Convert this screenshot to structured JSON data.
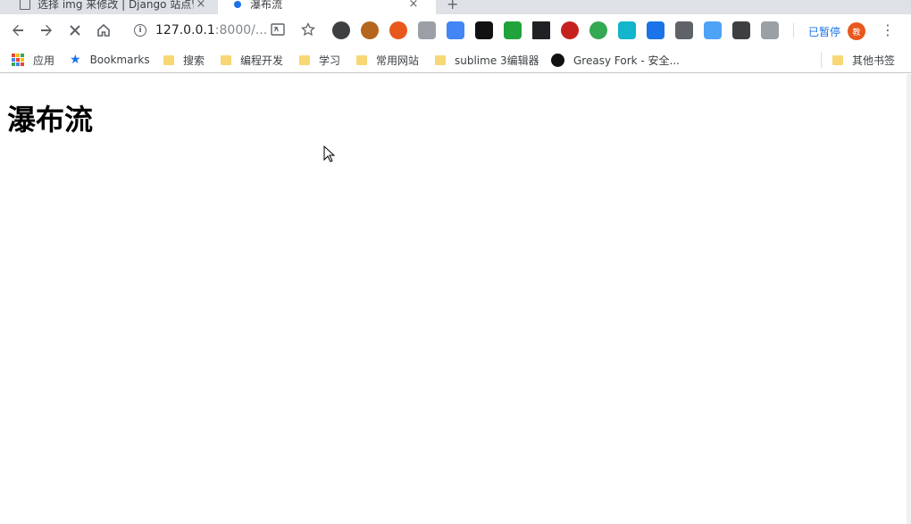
{
  "tabs": [
    {
      "title": "选择 img 来修改 | Django 站点管理",
      "close": "×"
    },
    {
      "title": "瀑布流",
      "close": "×"
    }
  ],
  "new_tab": "+",
  "address": {
    "host": "127.0.0.1",
    "path": ":8000/...",
    "info": "i"
  },
  "profile": {
    "paused_label": "已暂停",
    "avatar_text": "教"
  },
  "bookmarks": {
    "apps": "应用",
    "items": [
      "Bookmarks",
      "搜索",
      "编程开发",
      "学习",
      "常用网站",
      "sublime 3编辑器",
      "Greasy Fork - 安全..."
    ],
    "other": "其他书签"
  },
  "page": {
    "title": "瀑布流"
  },
  "colors": {
    "accent": "#1a73e8",
    "avatar": "#e8581c",
    "folder": "#f8d775"
  }
}
